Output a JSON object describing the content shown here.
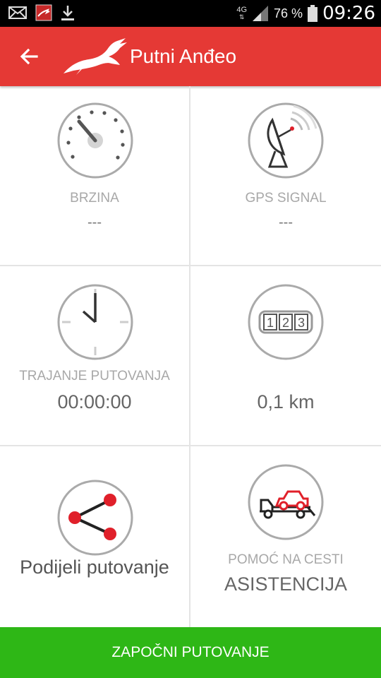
{
  "status_bar": {
    "network": "4G",
    "battery_percent": "76 %",
    "time": "09:26"
  },
  "app_bar": {
    "title": "Putni Anđeo"
  },
  "tiles": {
    "speed": {
      "label": "BRZINA",
      "value": "---"
    },
    "gps": {
      "label": "GPS SIGNAL",
      "value": "---"
    },
    "duration": {
      "label": "TRAJANJE PUTOVANJA",
      "value": "00:00:00"
    },
    "distance": {
      "label": "",
      "value": "0,1 km",
      "odometer_digits": [
        "1",
        "2",
        "3"
      ]
    },
    "share": {
      "label": "Podijeli putovanje"
    },
    "assist": {
      "label": "POMOĆ NA CESTI",
      "value": "ASISTENCIJA"
    }
  },
  "start_button": {
    "label": "ZAPOČNI PUTOVANJE"
  },
  "colors": {
    "app_bar": "#e53935",
    "accent_red": "#e0202a",
    "start_button": "#2eb716",
    "icon_stroke": "#9e9e9e"
  }
}
